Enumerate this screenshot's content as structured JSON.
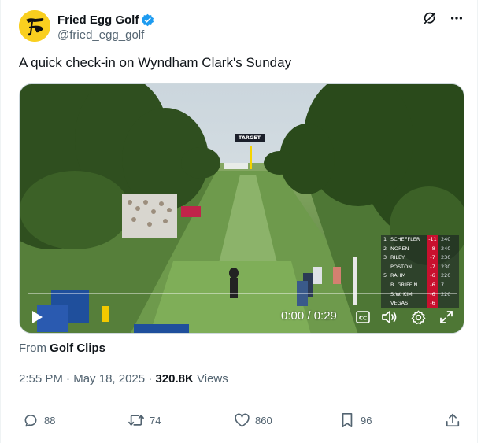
{
  "author": {
    "display_name": "Fried Egg Golf",
    "handle": "@fried_egg_golf",
    "verified": true,
    "avatar_color": "#f9cf1f"
  },
  "tweet": {
    "text": "A quick check-in on Wyndham Clark's Sunday"
  },
  "video": {
    "time_readout": "0:00 / 0:29",
    "progress": 0,
    "target_label": "TARGET",
    "leaderboard": [
      {
        "pos": "1",
        "name": "SCHEFFLER",
        "score": "-11",
        "thru": "240"
      },
      {
        "pos": "2",
        "name": "NOREN",
        "score": "-8",
        "thru": "240"
      },
      {
        "pos": "3",
        "name": "RILEY",
        "score": "-7",
        "thru": "230"
      },
      {
        "pos": "",
        "name": "POSTON",
        "score": "-7",
        "thru": "230"
      },
      {
        "pos": "5",
        "name": "RAHM",
        "score": "-6",
        "thru": "220"
      },
      {
        "pos": "",
        "name": "B. GRIFFIN",
        "score": "-6",
        "thru": "7"
      },
      {
        "pos": "",
        "name": "S.W. KIM",
        "score": "-6",
        "thru": "220"
      },
      {
        "pos": "",
        "name": "VEGAS",
        "score": "-6",
        "thru": ""
      }
    ]
  },
  "source": {
    "prefix": "From",
    "name": "Golf Clips"
  },
  "meta": {
    "time": "2:55 PM",
    "separator": " · ",
    "date": "May 18, 2025",
    "views_count": "320.8K",
    "views_label": "Views"
  },
  "actions": {
    "replies": "88",
    "reposts": "74",
    "likes": "860",
    "bookmarks": "96"
  },
  "colors": {
    "accent_blue": "#1d9bf0",
    "secondary_text": "#536471",
    "primary_text": "#0f1419",
    "score_red": "#c8102e"
  }
}
